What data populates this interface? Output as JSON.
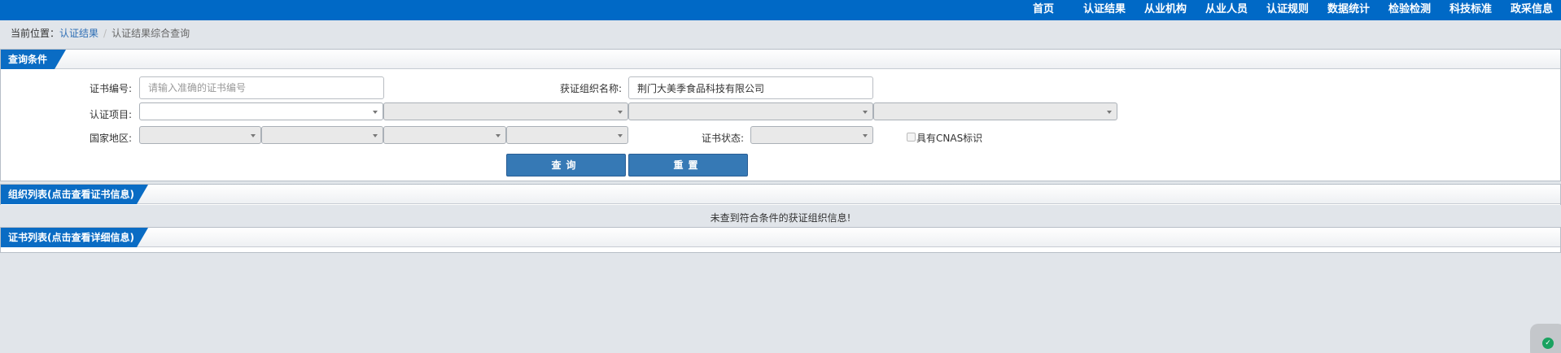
{
  "nav": [
    "首页",
    "认证结果",
    "从业机构",
    "从业人员",
    "认证规则",
    "数据统计",
    "检验检测",
    "科技标准",
    "政采信息"
  ],
  "breadcrumb": {
    "prefix": "当前位置：",
    "link": "认证结果",
    "separator": "/",
    "current": "认证结果综合查询"
  },
  "query_panel": {
    "title": "查询条件",
    "cert_no_label": "证书编号:",
    "cert_no_placeholder": "请输入准确的证书编号",
    "org_name_label": "获证组织名称:",
    "org_name_value": "荆门大美季食品科技有限公司",
    "cert_item_label": "认证项目:",
    "region_label": "国家地区:",
    "cert_status_label": "证书状态:",
    "cnas_label": "具有CNAS标识",
    "query_button": "查询",
    "reset_button": "重置"
  },
  "org_list": {
    "title": "组织列表(点击查看证书信息)",
    "empty_message": "未查到符合条件的获证组织信息!"
  },
  "cert_list": {
    "title": "证书列表(点击查看详细信息)"
  },
  "colors": {
    "topbar": "#0069c6",
    "button": "#3679b5",
    "tab": "#0a6cc4"
  },
  "icons": [
    "shield-check-icon",
    "dropdown-arrow-icon",
    "checkbox-icon"
  ]
}
